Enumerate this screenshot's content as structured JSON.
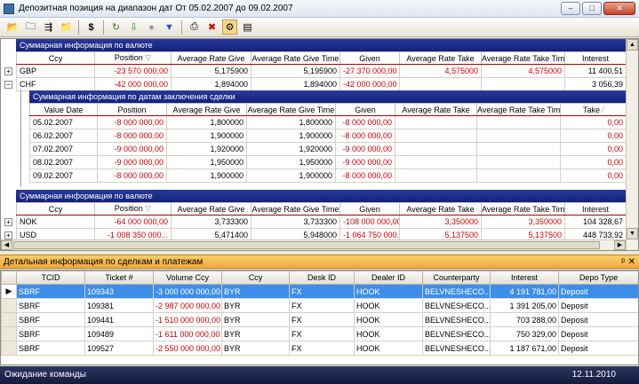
{
  "window": {
    "title": "Депозитная позиция на диапазон дат От 05.02.2007 до 09.02.2007",
    "btn_min": "–",
    "btn_max": "□",
    "btn_close": "✕"
  },
  "toolbar": {
    "icons": [
      "folder-open",
      "folder-save",
      "move",
      "folder",
      "dollar",
      "refresh",
      "export",
      "circle",
      "filter",
      "print",
      "delete",
      "settings",
      "report"
    ]
  },
  "upper": {
    "band1": "Суммарная информация по валюте",
    "cols1": [
      "Ccy",
      "Position",
      "Average Rate Give",
      "Average Rate Give Time",
      "Given",
      "Average Rate Take",
      "Average Rate Take Time",
      "Interest"
    ],
    "rows1": [
      {
        "ccy": "GBP",
        "position": "-23 570 000,00",
        "arg": "5,175900",
        "argt": "5,195900",
        "given": "-27 370 000,00",
        "art": "4,575000",
        "artt": "4,575000",
        "interest": "11 400,51",
        "expander": "+"
      },
      {
        "ccy": "CHF",
        "position": "-42 000 000,00",
        "arg": "1,894000",
        "argt": "1,894000",
        "given": "-42 000 000,00",
        "art": "",
        "artt": "",
        "interest": "3 056,39",
        "expander": "−"
      }
    ],
    "band2": "Суммарная информация по датам заключения сделки",
    "cols2": [
      "Value Date",
      "Position",
      "Average Rate Give",
      "Average Rate Give Time",
      "Given",
      "Average Rate Take",
      "Average Rate Take Time",
      "Take"
    ],
    "rows2": [
      {
        "date": "05.02.2007",
        "position": "-8 000 000,00",
        "arg": "1,800000",
        "argt": "1,800000",
        "given": "-8 000 000,00",
        "art": "",
        "artt": "",
        "take": "0,00"
      },
      {
        "date": "06.02.2007",
        "position": "-8 000 000,00",
        "arg": "1,900000",
        "argt": "1,900000",
        "given": "-8 000 000,00",
        "art": "",
        "artt": "",
        "take": "0,00"
      },
      {
        "date": "07.02.2007",
        "position": "-9 000 000,00",
        "arg": "1,920000",
        "argt": "1,920000",
        "given": "-9 000 000,00",
        "art": "",
        "artt": "",
        "take": "0,00"
      },
      {
        "date": "08.02.2007",
        "position": "-9 000 000,00",
        "arg": "1,950000",
        "argt": "1,950000",
        "given": "-9 000 000,00",
        "art": "",
        "artt": "",
        "take": "0,00"
      },
      {
        "date": "09.02.2007",
        "position": "-8 000 000,00",
        "arg": "1,900000",
        "argt": "1,900000",
        "given": "-8 000 000,00",
        "art": "",
        "artt": "",
        "take": "0,00"
      }
    ],
    "band3": "Суммарная информация по валюте",
    "cols3": [
      "Ccy",
      "Position",
      "Average Rate Give",
      "Average Rate Give Time",
      "Given",
      "Average Rate Take",
      "Average Rate Take Time",
      "Interest"
    ],
    "rows3": [
      {
        "ccy": "NOK",
        "position": "-64 000 000,00",
        "arg": "3,733300",
        "argt": "3,733300",
        "given": "-108 000 000,00",
        "art": "3,350000",
        "artt": "3,350000",
        "interest": "104 328,67",
        "expander": "+"
      },
      {
        "ccy": "USD",
        "position": "-1 008 350 000...",
        "arg": "5,471400",
        "argt": "5,948000",
        "given": "-1 064 750 000...",
        "art": "5,137500",
        "artt": "5,137500",
        "interest": "448 733,92",
        "expander": "+"
      }
    ]
  },
  "detail": {
    "title": "Детальная информация по сделкам и платежам",
    "pin": "ᵖ",
    "close": "✕",
    "cols": [
      "TCID",
      "Ticket #",
      "Volume Ccy",
      "Ccy",
      "Desk ID",
      "Dealer ID",
      "Counterparty",
      "Interest",
      "Depo Type"
    ],
    "rows": [
      {
        "tcid": "SBRF",
        "ticket": "109343",
        "volume": "-3 000 000 000,00",
        "ccy": "BYR",
        "desk": "FX",
        "dealer": "HOOK",
        "cpty": "BELVNESHECO...",
        "interest": "4 191 781,00",
        "depo": "Deposit"
      },
      {
        "tcid": "SBRF",
        "ticket": "109381",
        "volume": "-2 987 000 000,00",
        "ccy": "BYR",
        "desk": "FX",
        "dealer": "HOOK",
        "cpty": "BELVNESHECO...",
        "interest": "1 391 205,00",
        "depo": "Deposit"
      },
      {
        "tcid": "SBRF",
        "ticket": "109441",
        "volume": "-1 510 000 000,00",
        "ccy": "BYR",
        "desk": "FX",
        "dealer": "HOOK",
        "cpty": "BELVNESHECO...",
        "interest": "703 288,00",
        "depo": "Deposit"
      },
      {
        "tcid": "SBRF",
        "ticket": "109489",
        "volume": "-1 611 000 000,00",
        "ccy": "BYR",
        "desk": "FX",
        "dealer": "HOOK",
        "cpty": "BELVNESHECO...",
        "interest": "750 329,00",
        "depo": "Deposit"
      },
      {
        "tcid": "SBRF",
        "ticket": "109527",
        "volume": "-2 550 000 000,00",
        "ccy": "BYR",
        "desk": "FX",
        "dealer": "HOOK",
        "cpty": "BELVNESHECO...",
        "interest": "1 187 671,00",
        "depo": "Deposit"
      }
    ]
  },
  "status": {
    "text": "Ожидание команды",
    "date": "12.11.2010"
  },
  "colors": {
    "negative": "#d00000",
    "band": "#13217b",
    "selection": "#3d8ee8",
    "panel_header": "#f2a93a"
  }
}
